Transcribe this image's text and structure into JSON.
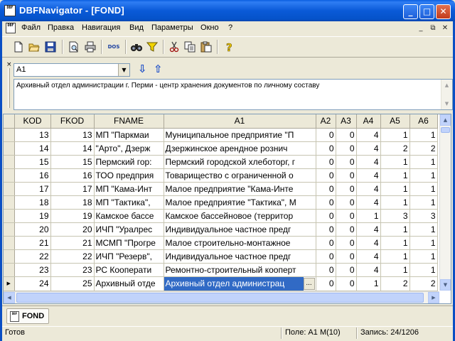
{
  "window": {
    "title": "DBFNavigator - [FOND]",
    "app_icon_label": "DBF",
    "minimize": "_",
    "maximize": "□",
    "close": "✕"
  },
  "menu": {
    "items": [
      "Файл",
      "Правка",
      "Навигация",
      "Вид",
      "Параметры",
      "Окно",
      "?"
    ],
    "mdi_minimize": "_",
    "mdi_restore": "⧉",
    "mdi_close": "✕"
  },
  "toolbar": {
    "buttons": [
      "new-icon",
      "open-folder-icon",
      "save-icon",
      "print-preview-icon",
      "print-icon",
      "dos-icon",
      "find-icon",
      "filter-icon",
      "cut-icon",
      "copy-icon",
      "paste-icon",
      "help-icon"
    ],
    "dos_label": "DOS"
  },
  "field_editor": {
    "close_label": "×",
    "field_select": "A1",
    "memo_text": "Архивный отдел администрации г. Перми - центр хранения документов по личному составу"
  },
  "grid": {
    "columns": [
      "KOD",
      "FKOD",
      "FNAME",
      "A1",
      "A2",
      "A3",
      "A4",
      "A5",
      "A6"
    ],
    "rows": [
      {
        "kod": "13",
        "fkod": "13",
        "fname": "МП \"Паркмаи",
        "a1": "Муниципальное предприятие \"П",
        "a2": "0",
        "a3": "0",
        "a4": "4",
        "a5": "1",
        "a6": "1"
      },
      {
        "kod": "14",
        "fkod": "14",
        "fname": "\"Арто\", Дзерж",
        "a1": "Дзержинское арендное рознич",
        "a2": "0",
        "a3": "0",
        "a4": "4",
        "a5": "2",
        "a6": "2"
      },
      {
        "kod": "15",
        "fkod": "15",
        "fname": "Пермский гор:",
        "a1": "Пермский городской хлеботорг, г",
        "a2": "0",
        "a3": "0",
        "a4": "4",
        "a5": "1",
        "a6": "1"
      },
      {
        "kod": "16",
        "fkod": "16",
        "fname": "ТОО предприя",
        "a1": "Товарищество с ограниченной о",
        "a2": "0",
        "a3": "0",
        "a4": "4",
        "a5": "1",
        "a6": "1"
      },
      {
        "kod": "17",
        "fkod": "17",
        "fname": "МП \"Кама-Инт",
        "a1": "Малое предприятие \"Кама-Инте",
        "a2": "0",
        "a3": "0",
        "a4": "4",
        "a5": "1",
        "a6": "1"
      },
      {
        "kod": "18",
        "fkod": "18",
        "fname": "МП \"Тактика\",",
        "a1": "Малое предприятие \"Тактика\", М",
        "a2": "0",
        "a3": "0",
        "a4": "4",
        "a5": "1",
        "a6": "1"
      },
      {
        "kod": "19",
        "fkod": "19",
        "fname": "Камское бассе",
        "a1": "Камское бассейновое (территор",
        "a2": "0",
        "a3": "0",
        "a4": "1",
        "a5": "3",
        "a6": "3"
      },
      {
        "kod": "20",
        "fkod": "20",
        "fname": "ИЧП \"Уралрес",
        "a1": "Индивидуальное частное предг",
        "a2": "0",
        "a3": "0",
        "a4": "4",
        "a5": "1",
        "a6": "1"
      },
      {
        "kod": "21",
        "fkod": "21",
        "fname": "МСМП \"Прогре",
        "a1": "Малое строительно-монтажное",
        "a2": "0",
        "a3": "0",
        "a4": "4",
        "a5": "1",
        "a6": "1"
      },
      {
        "kod": "22",
        "fkod": "22",
        "fname": "ИЧП \"Резерв\",",
        "a1": "Индивидуальное частное предг",
        "a2": "0",
        "a3": "0",
        "a4": "4",
        "a5": "1",
        "a6": "1"
      },
      {
        "kod": "23",
        "fkod": "23",
        "fname": "РС Кооперати",
        "a1": "Ремонтно-строительный кооперт",
        "a2": "0",
        "a3": "0",
        "a4": "4",
        "a5": "1",
        "a6": "1"
      },
      {
        "kod": "24",
        "fkod": "25",
        "fname": "Архивный отде",
        "a1": "Архивный отдел администрац",
        "a1_ellipsis": "...",
        "a2": "0",
        "a3": "0",
        "a4": "1",
        "a5": "2",
        "a6": "2",
        "current": true
      }
    ]
  },
  "tabs": [
    {
      "label": "FOND"
    }
  ],
  "status": {
    "state": "Готов",
    "field": "Поле: A1 M(10)",
    "record": "Запись: 24/1206"
  },
  "colors": {
    "title_bar": "#0a5ad8",
    "selection": "#316ac5",
    "chrome": "#ece9d8"
  }
}
